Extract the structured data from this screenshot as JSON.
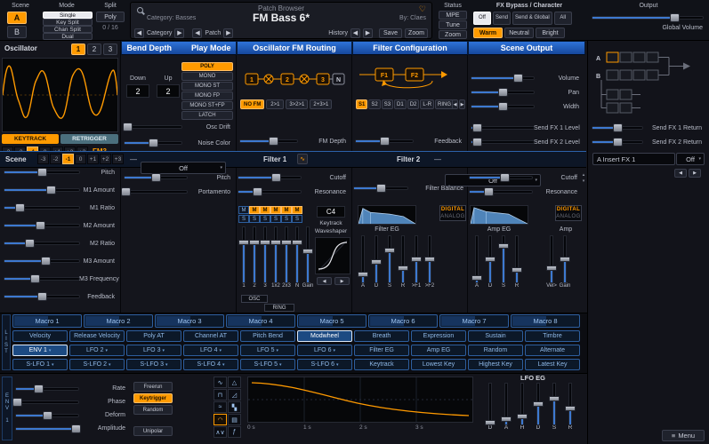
{
  "icons": {
    "prev": "◀",
    "next": "▶",
    "down": "▾",
    "up": "▴",
    "dash": "—",
    "heart": "♡",
    "menu": "≡",
    "analyze": "∿"
  },
  "topbar": {
    "scene": {
      "label": "Scene",
      "a": "A",
      "b": "B"
    },
    "mode": {
      "label": "Mode",
      "options": [
        {
          "label": "Single",
          "selected": true
        },
        {
          "label": "Key Split"
        },
        {
          "label": "Chan Split"
        },
        {
          "label": "Dual"
        }
      ]
    },
    "split": {
      "label": "Split",
      "value": "Poly",
      "voices": "0 / 16"
    },
    "patch": {
      "title": "Patch Browser",
      "category": "Category: Basses",
      "name": "FM Bass 6*",
      "author": "By: Claes",
      "nav_category": "Category",
      "nav_patch": "Patch",
      "history": "History",
      "save": "Save",
      "zoom": "Zoom"
    },
    "status": {
      "label": "Status",
      "items": [
        {
          "label": "MPE"
        },
        {
          "label": "Tune"
        },
        {
          "label": "Zoom"
        }
      ]
    },
    "fx_header": "FX Bypass / Character",
    "fx_bypass": [
      {
        "label": "Off",
        "selected": true
      },
      {
        "label": "Send"
      },
      {
        "label": "Send & Global"
      },
      {
        "label": "All"
      }
    ],
    "character": [
      {
        "label": "Warm",
        "selected": true
      },
      {
        "label": "Neutral"
      },
      {
        "label": "Bright"
      }
    ],
    "output": {
      "label": "Output",
      "volume_label": "Global Volume",
      "volume": 74
    }
  },
  "osc": {
    "title": "Oscillator",
    "tabs": [
      {
        "label": "1",
        "selected": true
      },
      {
        "label": "2"
      },
      {
        "label": "3"
      }
    ],
    "keytrack": "KEYTRACK",
    "retrigger": "RETRIGGER",
    "octaves": [
      {
        "label": "-3"
      },
      {
        "label": "-2"
      },
      {
        "label": "-1",
        "selected": true
      },
      {
        "label": "0"
      },
      {
        "label": "+1"
      },
      {
        "label": "+2"
      },
      {
        "label": "+3"
      }
    ],
    "type": "FM3",
    "params": [
      {
        "label": "Pitch",
        "value": 50
      },
      {
        "label": "M1 Amount",
        "value": 62
      },
      {
        "label": "M1 Ratio",
        "value": 20
      },
      {
        "label": "M2 Amount",
        "value": 48
      },
      {
        "label": "M2 Ratio",
        "value": 33
      },
      {
        "label": "M3 Amount",
        "value": 55
      },
      {
        "label": "M3 Frequency",
        "value": 40
      },
      {
        "label": "Feedback",
        "value": 50
      }
    ]
  },
  "bend": {
    "title": "Bend Depth",
    "play_title": "Play Mode",
    "down_label": "Down",
    "down_value": "2",
    "up_label": "Up",
    "up_value": "2",
    "modes": [
      {
        "label": "POLY",
        "selected": true
      },
      {
        "label": "MONO"
      },
      {
        "label": "MONO ST"
      },
      {
        "label": "MONO FP"
      },
      {
        "label": "MONO ST+FP"
      },
      {
        "label": "LATCH"
      }
    ],
    "params": [
      {
        "label": "Osc Drift",
        "value": 4
      },
      {
        "label": "Noise Color",
        "value": 50
      }
    ]
  },
  "fm": {
    "title": "Oscillator FM Routing",
    "nodes": [
      "1",
      "2",
      "3",
      "N"
    ],
    "options": [
      {
        "label": "NO FM",
        "selected": true
      },
      {
        "label": "2>1"
      },
      {
        "label": "3>2>1"
      },
      {
        "label": "2+3>1"
      }
    ],
    "params": [
      {
        "label": "FM Depth",
        "value": 58
      }
    ]
  },
  "filter_config": {
    "title": "Filter Configuration",
    "blocks": [
      "F1",
      "F2"
    ],
    "options": [
      {
        "label": "S1",
        "selected": true
      },
      {
        "label": "S2"
      },
      {
        "label": "S3"
      },
      {
        "label": "D1"
      },
      {
        "label": "D2"
      },
      {
        "label": "L-R"
      },
      {
        "label": "RING"
      }
    ],
    "params": [
      {
        "label": "Feedback",
        "value": 50
      }
    ]
  },
  "scene_output": {
    "title": "Scene Output",
    "main_params": [
      {
        "label": "Volume",
        "value": 74
      },
      {
        "label": "Pan",
        "value": 50
      },
      {
        "label": "Width",
        "value": 50
      }
    ],
    "send_params": [
      {
        "label": "Send FX 1 Level",
        "value": 8
      },
      {
        "label": "Send FX 2 Level",
        "value": 8
      }
    ]
  },
  "fx_panel": {
    "chain_a": "A",
    "chain_b": "B",
    "returns": [
      {
        "label": "Send FX 1 Return",
        "value": 50
      },
      {
        "label": "Send FX 2 Return",
        "value": 50
      }
    ],
    "insert_label": "A Insert FX 1",
    "insert_value": "Off"
  },
  "scene_row": {
    "label": "Scene",
    "octaves": [
      {
        "label": "-3"
      },
      {
        "label": "-2"
      },
      {
        "label": "-1",
        "selected": true
      },
      {
        "label": "0"
      },
      {
        "label": "+1"
      },
      {
        "label": "+2"
      },
      {
        "label": "+3"
      }
    ],
    "filter1_type": "Off",
    "filter1_label": "Filter 1",
    "filter2_label": "Filter 2",
    "filter2_type": "Off"
  },
  "scene_params": [
    {
      "label": "Pitch",
      "value": 50
    },
    {
      "label": "Portamento",
      "value": 2
    }
  ],
  "filter1_params": [
    {
      "label": "Cutoff",
      "value": 60
    },
    {
      "label": "Resonance",
      "value": 30
    }
  ],
  "balance_params": [
    {
      "label": "Filter Balance",
      "value": 50
    }
  ],
  "filter2_params": [
    {
      "label": "Cutoff",
      "value": 55
    },
    {
      "label": "Resonance",
      "value": 30
    }
  ],
  "mixer": {
    "mutes": [
      {
        "label": "M"
      },
      {
        "label": "M",
        "selected": true
      },
      {
        "label": "M",
        "selected": true
      },
      {
        "label": "M",
        "selected": true
      },
      {
        "label": "M",
        "selected": true
      },
      {
        "label": "M",
        "selected": true
      }
    ],
    "solos": [
      {
        "label": "S"
      },
      {
        "label": "S"
      },
      {
        "label": "S"
      },
      {
        "label": "S"
      },
      {
        "label": "S"
      },
      {
        "label": "S"
      }
    ],
    "channels": [
      {
        "label": "1",
        "value": 72
      },
      {
        "label": "2",
        "value": 72
      },
      {
        "label": "3",
        "value": 72
      },
      {
        "label": "1x2",
        "value": 72
      },
      {
        "label": "2x3",
        "value": 72
      },
      {
        "label": "N",
        "value": 72
      },
      {
        "label": "Gain",
        "value": 56
      }
    ],
    "group_osc": "OSC",
    "group_ring": "RING"
  },
  "ws": {
    "root_note": "C4",
    "keytrack_label": "Keytrack",
    "title": "Waveshaper"
  },
  "filter_eg": {
    "title": "Filter EG",
    "digital": "DIGITAL",
    "analog": "ANALOG",
    "sliders": [
      {
        "label": "A",
        "value": 18
      },
      {
        "label": "D",
        "value": 45
      },
      {
        "label": "S",
        "value": 70
      },
      {
        "label": "R",
        "value": 30
      },
      {
        "label": ">F1",
        "value": 50
      },
      {
        "label": ">F2",
        "value": 50
      }
    ]
  },
  "amp_eg": {
    "title": "Amp EG",
    "amp_title": "Amp",
    "digital": "DIGITAL",
    "analog": "ANALOG",
    "sliders": [
      {
        "label": "A",
        "value": 10
      },
      {
        "label": "D",
        "value": 50
      },
      {
        "label": "S",
        "value": 78
      },
      {
        "label": "R",
        "value": 26
      }
    ],
    "amp_sliders": [
      {
        "label": "Vel>",
        "value": 30
      },
      {
        "label": "Gain",
        "value": 50
      }
    ]
  },
  "list_tab": "LIST",
  "macros": [
    {
      "label": "Macro 1"
    },
    {
      "label": "Macro 2"
    },
    {
      "label": "Macro 3"
    },
    {
      "label": "Macro 4"
    },
    {
      "label": "Macro 5"
    },
    {
      "label": "Macro 6"
    },
    {
      "label": "Macro 7"
    },
    {
      "label": "Macro 8"
    }
  ],
  "mod_rows": {
    "row1": [
      {
        "label": "Velocity"
      },
      {
        "label": "Release Velocity"
      },
      {
        "label": "Poly AT"
      },
      {
        "label": "Channel AT"
      },
      {
        "label": "Pitch Bend"
      },
      {
        "label": "Modwheel",
        "selected": true
      },
      {
        "label": "Breath"
      },
      {
        "label": "Expression"
      },
      {
        "label": "Sustain"
      },
      {
        "label": "Timbre"
      }
    ],
    "row2": [
      {
        "label": "ENV 1",
        "selected": true,
        "arrow": true
      },
      {
        "label": "LFO 2",
        "arrow": true
      },
      {
        "label": "LFO 3",
        "arrow": true
      },
      {
        "label": "LFO 4",
        "arrow": true
      },
      {
        "label": "LFO 5",
        "arrow": true
      },
      {
        "label": "LFO 6",
        "arrow": true
      },
      {
        "label": "Filter EG"
      },
      {
        "label": "Amp EG"
      },
      {
        "label": "Random"
      },
      {
        "label": "Alternate"
      }
    ],
    "row3": [
      {
        "label": "S-LFO 1",
        "arrow": true
      },
      {
        "label": "S-LFO 2",
        "arrow": true
      },
      {
        "label": "S-LFO 3",
        "arrow": true
      },
      {
        "label": "S-LFO 4",
        "arrow": true
      },
      {
        "label": "S-LFO 5",
        "arrow": true
      },
      {
        "label": "S-LFO 6",
        "arrow": true
      },
      {
        "label": "Keytrack"
      },
      {
        "label": "Lowest Key"
      },
      {
        "label": "Highest Key"
      },
      {
        "label": "Latest Key"
      }
    ]
  },
  "lfo": {
    "env_tab": "ENV 1",
    "params": [
      {
        "label": "Rate",
        "value": 35
      },
      {
        "label": "Phase",
        "value": 2
      },
      {
        "label": "Deform",
        "value": 50
      },
      {
        "label": "Amplitude",
        "value": 96
      }
    ],
    "triggers": [
      {
        "label": "Freerun"
      },
      {
        "label": "Keytrigger",
        "selected": true
      },
      {
        "label": "Random"
      }
    ],
    "unipolar": "Unipolar",
    "shapes": [
      {
        "name": "sine",
        "glyph": "∿"
      },
      {
        "name": "triangle",
        "glyph": "△"
      },
      {
        "name": "square",
        "glyph": "⊓"
      },
      {
        "name": "ramp",
        "glyph": "◿"
      },
      {
        "name": "noise",
        "glyph": "≈"
      },
      {
        "name": "snh",
        "glyph": "▚"
      },
      {
        "name": "envelope",
        "glyph": "◠",
        "selected": true
      },
      {
        "name": "stepseq",
        "glyph": "▤"
      },
      {
        "name": "mseg",
        "glyph": "∧∨"
      },
      {
        "name": "formula",
        "glyph": "ƒ"
      }
    ],
    "time_labels": [
      "0 s",
      "1 s",
      "2 s",
      "3 s"
    ],
    "eg_title": "LFO EG",
    "eg_sliders": [
      {
        "label": "D",
        "value": 4
      },
      {
        "label": "A",
        "value": 12
      },
      {
        "label": "H",
        "value": 20
      },
      {
        "label": "D",
        "value": 50
      },
      {
        "label": "S",
        "value": 62
      },
      {
        "label": "R",
        "value": 40
      }
    ],
    "menu": "Menu"
  }
}
